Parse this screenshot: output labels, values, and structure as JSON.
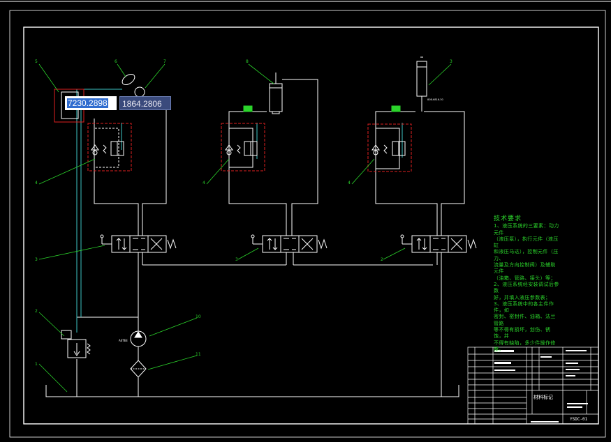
{
  "coord_readout": {
    "x": "7230.2898",
    "y": "1864.2806"
  },
  "callouts": {
    "c1": "1",
    "c2": "2",
    "c3": "3",
    "c4": "4",
    "c5": "5",
    "c6": "6",
    "c7": "7",
    "c8": "8",
    "c10": "10",
    "c11": "11",
    "c4b": "4",
    "c3b": "3",
    "c4c": "4",
    "c2b": "2",
    "c3c": "3"
  },
  "tech_notes": {
    "title": "技术要求",
    "lines": [
      "1、液压系统的三要素：动力元件",
      "（液压泵），执行元件（液压缸",
      "和液压马达），控制元件（压力、",
      "流量及方向控制阀）及辅助元件",
      "（油箱、管路、接头）等；",
      "2、液压系统经安装调试后参数",
      "好，并填入液压参数表；",
      "3、液压系统中的各主件作件，如",
      "密封、密封件、油箱、法兰管路",
      "等不得有损坏，划伤、锈蚀，并",
      "不得有缺陷，多少件操作修整。"
    ]
  },
  "labels": {
    "pump_tag": "ASTEE",
    "cyl3_tag": "80B-6816-30",
    "title_block_main": "材料标记",
    "drawing_no": "YSDC-01"
  },
  "colors": {
    "background": "#000000",
    "lines": "#ffffff",
    "highlight": "#e02020",
    "leaders": "#2bd42b",
    "pilot": "#3ec6c6"
  }
}
